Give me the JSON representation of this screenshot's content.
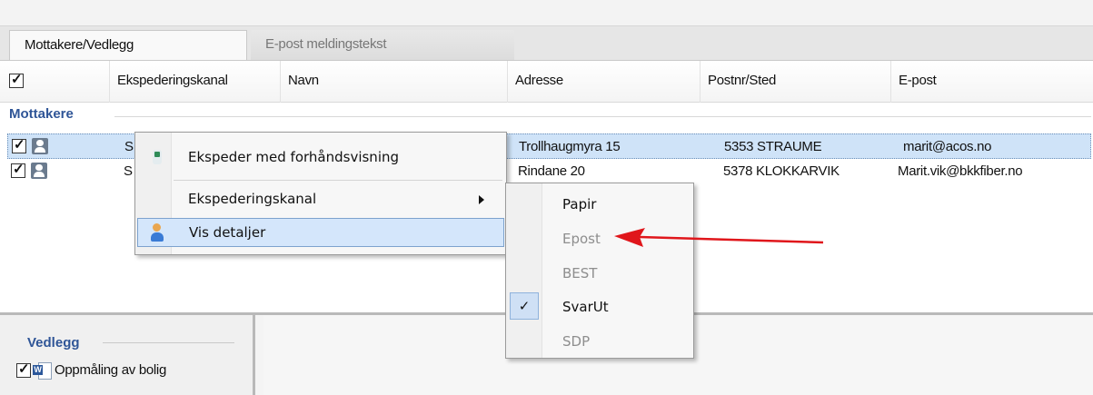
{
  "tabs": [
    {
      "label": "Mottakere/Vedlegg",
      "active": true
    },
    {
      "label": "E-post meldingstekst",
      "active": false
    }
  ],
  "grid": {
    "columns": [
      "Ekspederingskanal",
      "Navn",
      "Adresse",
      "Postnr/Sted",
      "E-post"
    ],
    "group_label": "Mottakere",
    "rows": [
      {
        "checked": true,
        "selected": true,
        "kanal": "S",
        "adresse": "Trollhaugmyra 15",
        "postnr": "5353 STRAUME",
        "epost": "marit@acos.no"
      },
      {
        "checked": true,
        "selected": false,
        "kanal": "S",
        "adresse": "Rindane 20",
        "postnr": "5378 KLOKKARVIK",
        "epost": "Marit.vik@bkkfiber.no"
      }
    ]
  },
  "context_menu": {
    "items": [
      {
        "label": "Ekspeder med forhåndsvisning",
        "icon": "send-icon"
      },
      {
        "label": "Ekspederingskanal",
        "has_submenu": true
      },
      {
        "label": "Vis detaljer",
        "icon": "person-details-icon",
        "highlighted": true
      }
    ]
  },
  "submenu": {
    "items": [
      {
        "label": "Papir",
        "enabled": true
      },
      {
        "label": "Epost",
        "enabled": false
      },
      {
        "label": "BEST",
        "enabled": false
      },
      {
        "label": "SvarUt",
        "enabled": true,
        "checked": true
      },
      {
        "label": "SDP",
        "enabled": false
      }
    ]
  },
  "attachments": {
    "group_label": "Vedlegg",
    "items": [
      {
        "label": "Oppmåling av bolig",
        "checked": true,
        "icon": "word-document-icon"
      }
    ]
  },
  "annotation": {
    "color": "#e0161b"
  },
  "colors": {
    "group_label": "#2f5597",
    "selection": "#cfe3f8"
  }
}
